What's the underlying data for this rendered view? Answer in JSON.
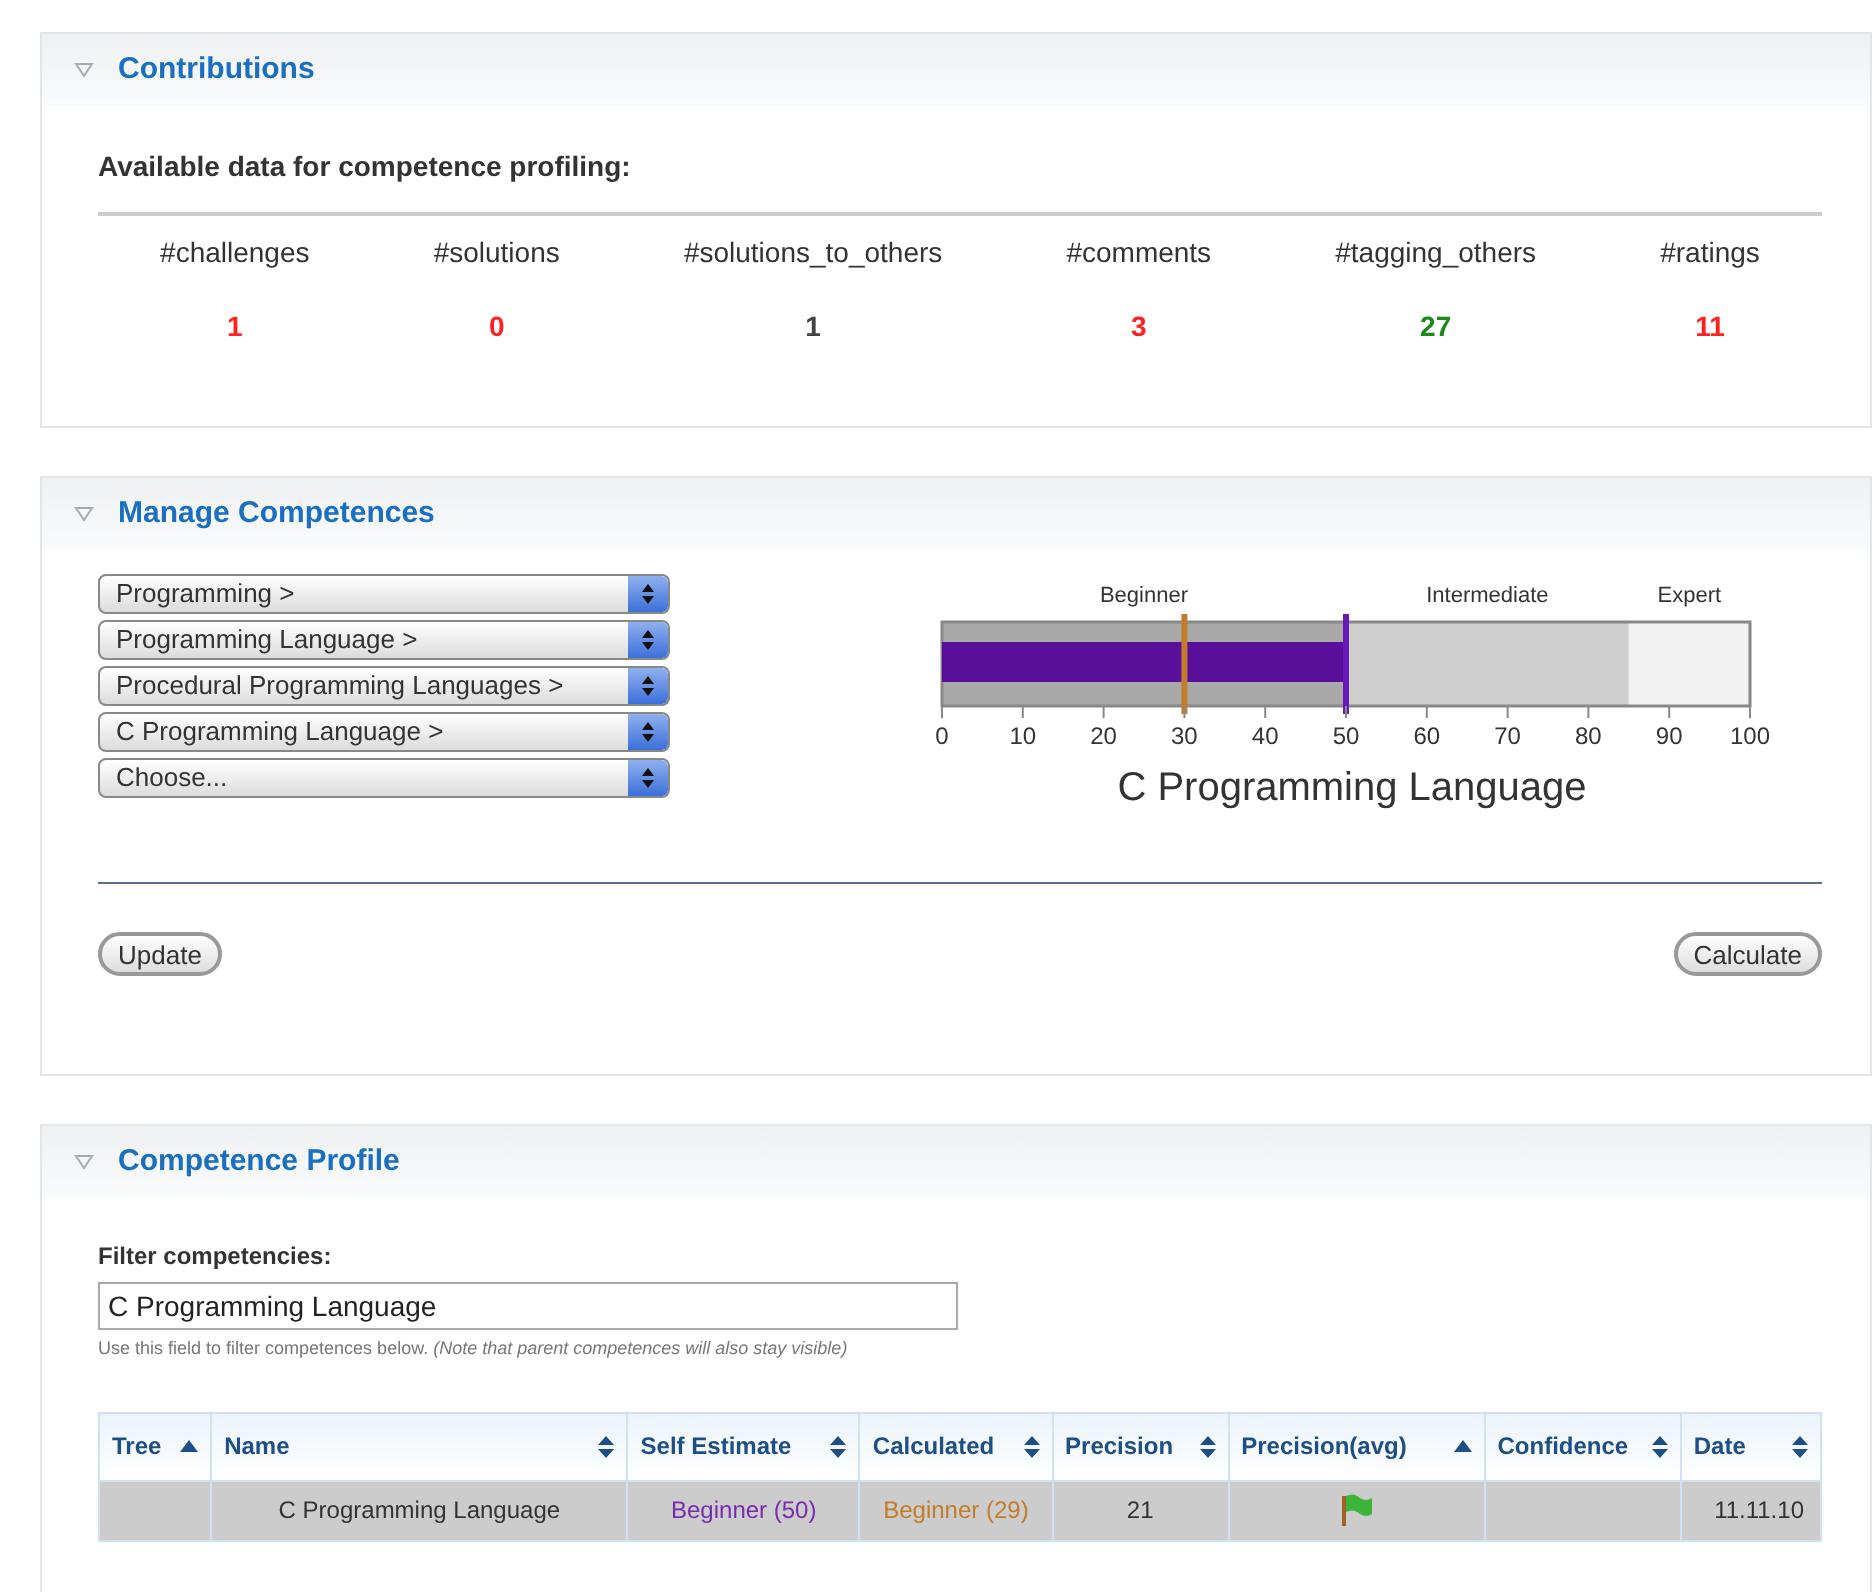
{
  "contributions": {
    "title": "Contributions",
    "expanded": true,
    "subtitle": "Available data for competence profiling:",
    "stats": [
      {
        "label": "#challenges",
        "value": "1",
        "color": "#ff2020"
      },
      {
        "label": "#solutions",
        "value": "0",
        "color": "#ff2020"
      },
      {
        "label": "#solutions_to_others",
        "value": "1",
        "color": "#444444"
      },
      {
        "label": "#comments",
        "value": "3",
        "color": "#ff2020"
      },
      {
        "label": "#tagging_others",
        "value": "27",
        "color": "#1a8a1a"
      },
      {
        "label": "#ratings",
        "value": "11",
        "color": "#ff2020"
      }
    ]
  },
  "manage": {
    "title": "Manage Competences",
    "expanded": true,
    "selects": [
      "Programming >",
      "Programming Language >",
      "Procedural Programming Languages >",
      "C Programming Language >",
      "Choose..."
    ],
    "gauge": {
      "title": "C Programming Language",
      "ranges": [
        {
          "label": "Beginner"
        },
        {
          "label": "Intermediate"
        },
        {
          "label": "Expert"
        }
      ],
      "ticks": [
        "0",
        "10",
        "20",
        "30",
        "40",
        "50",
        "60",
        "70",
        "80",
        "90",
        "100"
      ],
      "self_estimate": {
        "level": 0.5
      },
      "calculated": {
        "level": 0.3
      }
    },
    "update_button": "Update",
    "calculate_button": "Calculate"
  },
  "profile": {
    "title": "Competence Profile",
    "expanded": true,
    "filter_label": "Filter competencies:",
    "filter_value": "C Programming Language",
    "filter_hint": "Use this field to filter competences below. *(Note that parent competences will also stay visible)*",
    "columns": [
      {
        "label": "Tree",
        "sorted": true
      },
      {
        "label": "Name",
        "sorted": false
      },
      {
        "label": "Self Estimate",
        "sorted": false
      },
      {
        "label": "Calculated",
        "sorted": false
      },
      {
        "label": "Precision",
        "sorted": false
      },
      {
        "label": "Precision(avg)",
        "sorted": true
      },
      {
        "label": "Confidence",
        "sorted": false
      },
      {
        "label": "Date",
        "sorted": false
      }
    ],
    "rows": [
      {
        "name": "C Programming Language",
        "self_estimate": "Beginner (50)",
        "calculated": "Beginner (29)",
        "precision": "21",
        "flag": true,
        "date": "11.11.10"
      }
    ]
  }
}
